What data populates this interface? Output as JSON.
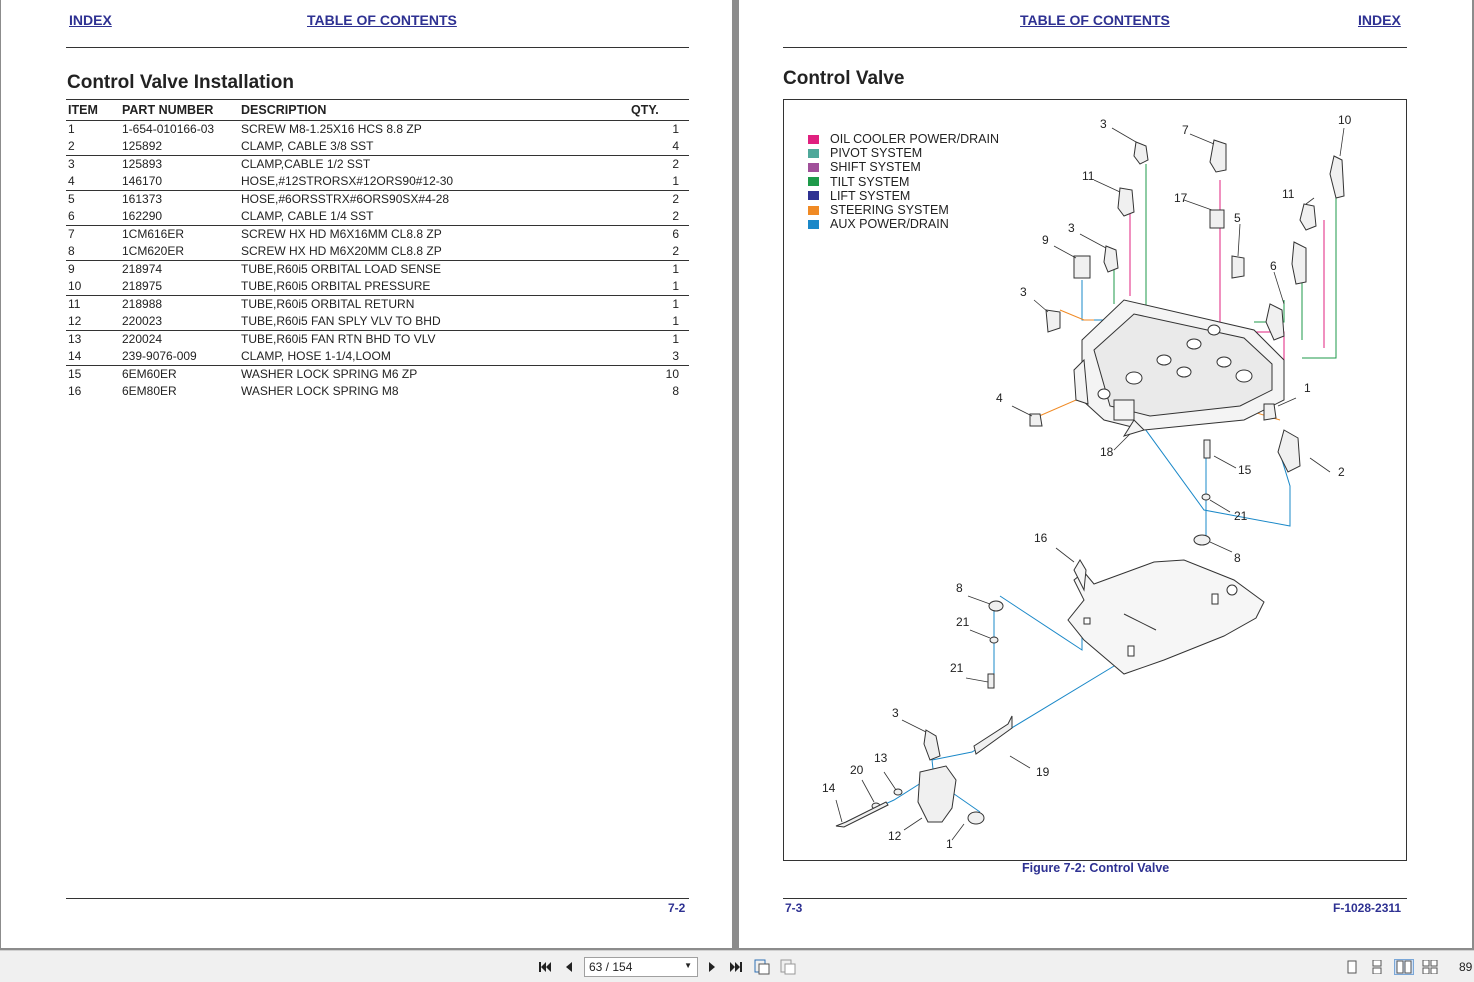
{
  "left_page": {
    "index_link": "INDEX",
    "toc_link": "TABLE OF CONTENTS",
    "title": "Control Valve Installation",
    "columns": [
      "ITEM",
      "PART NUMBER",
      "DESCRIPTION",
      "QTY."
    ],
    "rows": [
      {
        "item": "1",
        "part": "1-654-010166-03",
        "desc": "SCREW M8-1.25X16 HCS 8.8 ZP",
        "qty": "1"
      },
      {
        "item": "2",
        "part": "125892",
        "desc": "CLAMP, CABLE 3/8 SST",
        "qty": "4"
      },
      {
        "item": "3",
        "part": "125893",
        "desc": "CLAMP,CABLE 1/2 SST",
        "qty": "2"
      },
      {
        "item": "4",
        "part": "146170",
        "desc": "HOSE,#12STRORSX#12ORS90#12-30",
        "qty": "1"
      },
      {
        "item": "5",
        "part": "161373",
        "desc": "HOSE,#6ORSSTRX#6ORS90SX#4-28",
        "qty": "2"
      },
      {
        "item": "6",
        "part": "162290",
        "desc": "CLAMP, CABLE 1/4 SST",
        "qty": "2"
      },
      {
        "item": "7",
        "part": "1CM616ER",
        "desc": "SCREW HX HD M6X16MM CL8.8 ZP",
        "qty": "6"
      },
      {
        "item": "8",
        "part": "1CM620ER",
        "desc": "SCREW HX HD M6X20MM CL8.8 ZP",
        "qty": "2"
      },
      {
        "item": "9",
        "part": "218974",
        "desc": "TUBE,R60i5 ORBITAL LOAD SENSE",
        "qty": "1"
      },
      {
        "item": "10",
        "part": "218975",
        "desc": "TUBE,R60i5 ORBITAL PRESSURE",
        "qty": "1"
      },
      {
        "item": "11",
        "part": "218988",
        "desc": "TUBE,R60i5 ORBITAL RETURN",
        "qty": "1"
      },
      {
        "item": "12",
        "part": "220023",
        "desc": "TUBE,R60i5 FAN SPLY VLV TO BHD",
        "qty": "1"
      },
      {
        "item": "13",
        "part": "220024",
        "desc": "TUBE,R60i5 FAN RTN BHD TO VLV",
        "qty": "1"
      },
      {
        "item": "14",
        "part": "239-9076-009",
        "desc": "CLAMP, HOSE 1-1/4,LOOM",
        "qty": "3"
      },
      {
        "item": "15",
        "part": "6EM60ER",
        "desc": "WASHER LOCK SPRING M6 ZP",
        "qty": "10"
      },
      {
        "item": "16",
        "part": "6EM80ER",
        "desc": "WASHER LOCK SPRING M8",
        "qty": "8"
      }
    ],
    "page_number": "7-2"
  },
  "right_page": {
    "toc_link": "TABLE OF CONTENTS",
    "index_link": "INDEX",
    "title": "Control Valve",
    "legend": [
      {
        "label": "OIL COOLER POWER/DRAIN",
        "color": "#e0207f"
      },
      {
        "label": "PIVOT SYSTEM",
        "color": "#4fa89a"
      },
      {
        "label": "SHIFT SYSTEM",
        "color": "#a0509a"
      },
      {
        "label": "TILT SYSTEM",
        "color": "#1e9a4a"
      },
      {
        "label": "LIFT SYSTEM",
        "color": "#2e3192"
      },
      {
        "label": "STEERING SYSTEM",
        "color": "#f08a24"
      },
      {
        "label": "AUX POWER/DRAIN",
        "color": "#1a88c8"
      }
    ],
    "callouts": [
      "3",
      "7",
      "10",
      "11",
      "17",
      "11",
      "3",
      "9",
      "5",
      "6",
      "3",
      "4",
      "1",
      "18",
      "15",
      "2",
      "21",
      "16",
      "8",
      "8",
      "21",
      "21",
      "3",
      "19",
      "13",
      "20",
      "14",
      "12",
      "1"
    ],
    "caption": "Figure 7-2:  Control Valve",
    "page_number": "7-3",
    "doc_number": "F-1028-2311"
  },
  "toolbar": {
    "page_value": "63 / 154",
    "zoom": "89"
  }
}
